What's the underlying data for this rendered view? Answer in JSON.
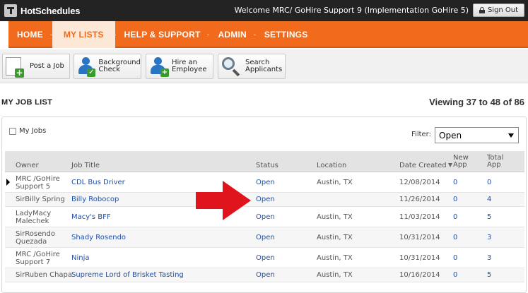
{
  "app": {
    "logo_text": "HotSchedules"
  },
  "header": {
    "welcome": "Welcome MRC/ GoHire Support 9 (Implementation GoHire 5)",
    "signout_label": "Sign Out"
  },
  "nav": {
    "items": [
      {
        "label": "HOME",
        "active": false
      },
      {
        "label": "MY LISTS",
        "active": true
      },
      {
        "label": "HELP & SUPPORT",
        "active": false
      },
      {
        "label": "ADMIN",
        "active": false
      },
      {
        "label": "SETTINGS",
        "active": false
      }
    ]
  },
  "toolbar": {
    "buttons": [
      {
        "line1": "Post a Job",
        "line2": "",
        "icon": "post-job-icon"
      },
      {
        "line1": "Background",
        "line2": "Check",
        "icon": "background-check-icon"
      },
      {
        "line1": "Hire an",
        "line2": "Employee",
        "icon": "hire-employee-icon"
      },
      {
        "line1": "Search",
        "line2": "Applicants",
        "icon": "search-applicants-icon"
      }
    ]
  },
  "list": {
    "title": "MY JOB LIST",
    "viewing": "Viewing 37 to 48 of 86",
    "my_jobs_label": "My Jobs",
    "filter_label": "Filter:",
    "filter_value": "Open"
  },
  "table": {
    "headers": {
      "owner": "Owner",
      "job_title": "Job Title",
      "status": "Status",
      "location": "Location",
      "date_created": "Date Created",
      "new_app_1": "New",
      "new_app_2": "App",
      "total_app_1": "Total",
      "total_app_2": "App"
    },
    "rows": [
      {
        "owner": [
          "MRC /GoHire",
          "Support 5"
        ],
        "title": "CDL Bus Driver",
        "status": "Open",
        "location": "Austin, TX",
        "date": "12/08/2014",
        "new": "0",
        "total": "0"
      },
      {
        "owner": [
          "SirBilly Spring"
        ],
        "title": "Billy Robocop",
        "status": "Open",
        "location": "",
        "date": "11/26/2014",
        "new": "0",
        "total": "4"
      },
      {
        "owner": [
          "LadyMacy",
          "Malechek"
        ],
        "title": "Macy's BFF",
        "status": "Open",
        "location": "Austin, TX",
        "date": "11/03/2014",
        "new": "0",
        "total": "5"
      },
      {
        "owner": [
          "SirRosendo",
          "Quezada"
        ],
        "title": "Shady Rosendo",
        "status": "Open",
        "location": "Austin, TX",
        "date": "10/31/2014",
        "new": "0",
        "total": "3"
      },
      {
        "owner": [
          "MRC /GoHire",
          "Support 7"
        ],
        "title": "Ninja",
        "status": "Open",
        "location": "Austin, TX",
        "date": "10/31/2014",
        "new": "0",
        "total": "3"
      },
      {
        "owner": [
          "SirRuben Chapa"
        ],
        "title": "Supreme Lord of Brisket Tasting",
        "status": "Open",
        "location": "Austin, TX",
        "date": "10/16/2014",
        "new": "0",
        "total": "5"
      }
    ]
  },
  "colors": {
    "nav_orange": "#f26b1d",
    "link_blue": "#1f4fa8",
    "arrow_red": "#e0141c",
    "topbar": "#232323"
  }
}
